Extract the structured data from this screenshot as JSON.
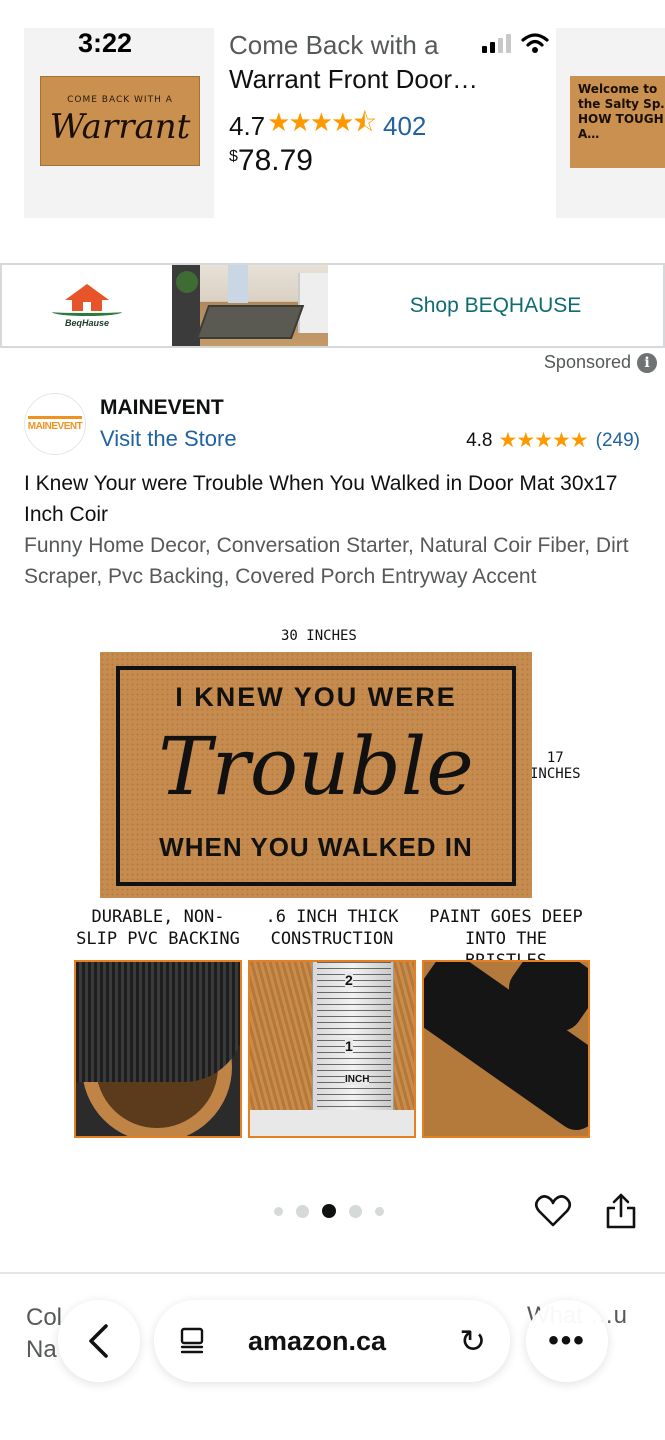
{
  "status_bar": {
    "time": "3:22"
  },
  "recommended": {
    "thumb_small_text": "COME BACK WITH A",
    "thumb_big_text": "Warrant",
    "title_line1": "Come Back with a",
    "title_line2": "Warrant Front Door…",
    "rating": "4.7",
    "stars": "★★★★⯪",
    "review_count": "402",
    "price_symbol": "$",
    "price": "78.79",
    "next_thumb_text": "Welcome to the Salty Sp… HOW TOUGH A…"
  },
  "banner": {
    "brand_logo_text": "BeqHause",
    "cta": "Shop BEQHAUSE"
  },
  "sponsored": {
    "label": "Sponsored",
    "info_icon": "i"
  },
  "brand": {
    "logo_text": "MAINEVENT",
    "name": "MAINEVENT",
    "visit_store": "Visit the Store",
    "rating": "4.8",
    "stars": "★★★★★",
    "review_count": "(249)"
  },
  "ad": {
    "title": "I Knew Your were Trouble When You Walked in Door Mat 30x17 Inch Coir",
    "subtitle": "Funny Home Decor, Conversation Starter, Natural Coir Fiber, Dirt Scraper, Pvc Backing, Covered Porch Entryway Accent"
  },
  "hero": {
    "width_label": "30 INCHES",
    "height_label_1": "17",
    "height_label_2": "INCHES",
    "mat_line1": "I KNEW YOU WERE",
    "mat_line2": "Trouble",
    "mat_line3": "WHEN YOU WALKED IN",
    "features": [
      {
        "line1": "DURABLE, NON-",
        "line2": "SLIP PVC BACKING"
      },
      {
        "line1": ".6 INCH THICK",
        "line2": "CONSTRUCTION"
      },
      {
        "line1": "PAINT GOES DEEP",
        "line2": "INTO THE BRISTLES"
      }
    ],
    "ruler_numbers": [
      "2",
      "1",
      "INCH"
    ]
  },
  "carousel": {
    "total": 5,
    "active_index": 2
  },
  "bottom_peek": {
    "left_line1": "Col",
    "left_line2": "Na",
    "right": "What …u"
  },
  "browser": {
    "back_icon": "‹",
    "host": "amazon.ca",
    "reload_icon": "↻",
    "more_icon": "•••"
  },
  "colors": {
    "star": "#ff9900",
    "link": "#2162a1",
    "banner_cta": "#0e6b73",
    "feature_border": "#e67e22"
  }
}
